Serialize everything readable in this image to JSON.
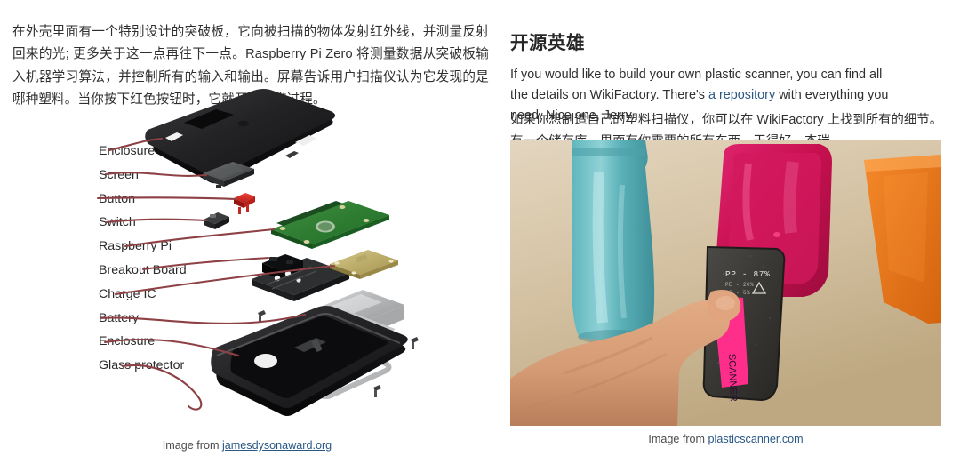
{
  "left_column": {
    "paragraph_cn": "在外壳里面有一个特别设计的突破板，它向被扫描的物体发射红外线，并测量反射回来的光; 更多关于这一点再往下一点。Raspberry Pi Zero 将测量数据从突破板输入机器学习算法，并控制所有的输入和输出。屏幕告诉用户扫描仪认为它发现的是哪种塑料。当你按下红色按钮时，它就开始扫描过程。",
    "diagram": {
      "alt": "exploded-view-diagram-of-plastic-scanner",
      "leader_line_color": "#8e4145",
      "labels": [
        "Enclosure",
        "Screen",
        "Button",
        "Switch",
        "Raspberry Pi",
        "Breakout Board",
        "Charge IC",
        "Battery",
        "Enclosure",
        "Glass protector"
      ]
    },
    "caption": {
      "prefix": "Image from ",
      "link_text": "jamesdysonaward.org"
    }
  },
  "right_column": {
    "heading_cn": "开源英雄",
    "paragraph_en": {
      "before_link": "If you would like to build your own plastic scanner, you can find all the details on WikiFactory. There's ",
      "link_text": "a repository",
      "after_link": " with everything you need. Nice one, Jerry."
    },
    "paragraph_cn": "如果你想制造自己的塑料扫描仪，你可以在 WikiFactory 上找到所有的细节。有一个储存库，里面有你需要的所有东西。干得好，杰瑞。",
    "photo": {
      "alt": "hand-holding-plastic-scanner-against-pink-container",
      "background_color": "#d7c6ad",
      "screen_lines": [
        "PP - 87%",
        "PE - 20%",
        "PS - 6%"
      ],
      "sticker_text": "SCANNER",
      "objects": [
        "teal-bottle",
        "pink-container-lid",
        "orange-tray"
      ]
    },
    "caption": {
      "prefix": "Image from ",
      "link_text": "plasticscanner.com"
    }
  }
}
